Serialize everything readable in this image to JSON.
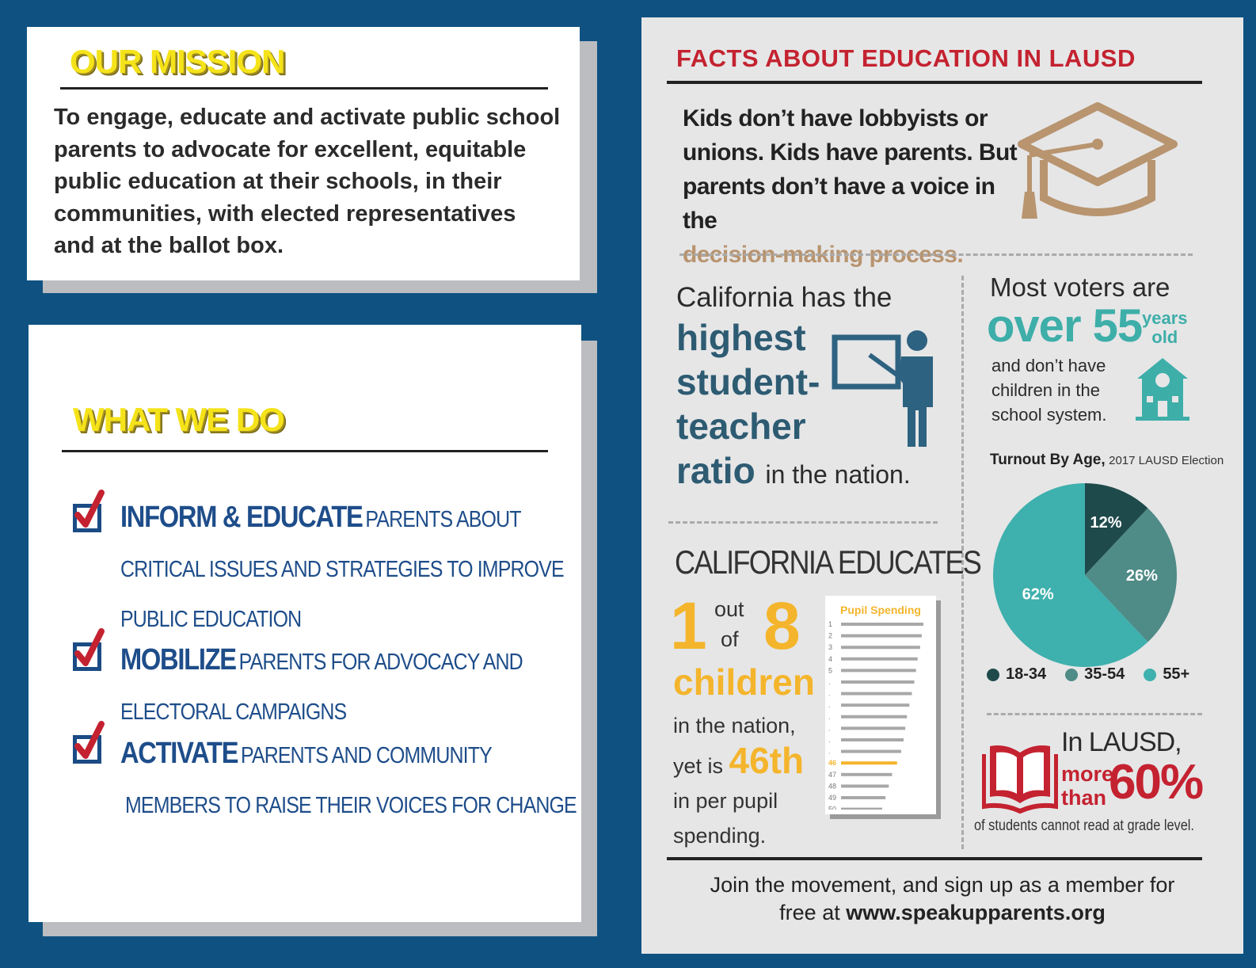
{
  "mission": {
    "heading": "OUR MISSION",
    "text": "To engage, educate and activate public school parents to advocate for excellent, equitable public education at their schools, in their communities, with elected representatives and at the ballot box."
  },
  "what_we_do": {
    "heading": "WHAT WE DO",
    "items": [
      {
        "lead": "INFORM & EDUCATE",
        "line1": "PARENTS ABOUT",
        "line2": "CRITICAL ISSUES AND STRATEGIES TO IMPROVE",
        "line3": "PUBLIC EDUCATION"
      },
      {
        "lead": "MOBILIZE",
        "line1": "PARENTS FOR ADVOCACY AND",
        "line2": "ELECTORAL CAMPAIGNS"
      },
      {
        "lead": "ACTIVATE",
        "line1": "PARENTS AND COMMUNITY",
        "line2": "MEMBERS TO RAISE THEIR VOICES FOR CHANGE"
      }
    ]
  },
  "facts": {
    "title": "FACTS ABOUT EDUCATION IN LAUSD",
    "kids_line1": "Kids don’t have lobbyists or",
    "kids_line2": "unions. Kids have parents. But",
    "kids_line3": "parents don’t have a voice in the",
    "kids_highlight": "decision-making process.",
    "ratio_intro": "California has the",
    "ratio_w1": "highest",
    "ratio_w2": "student-",
    "ratio_w3": "teacher",
    "ratio_w4": "ratio",
    "ratio_tail": "in the nation.",
    "voters_intro": "Most voters are",
    "voters_big": "over 55",
    "voters_years": "years",
    "voters_old": "old",
    "voters_l1": "and don’t have",
    "voters_l2": "children in the",
    "voters_l3": "school system.",
    "educates_title": "CALIFORNIA EDUCATES",
    "num1": "1",
    "out": "out",
    "of": "of",
    "num8": "8",
    "children": "children",
    "in_nation": "in the nation,",
    "yet_is": "yet is",
    "rank": "46th",
    "per_pupil": "in per pupil",
    "spending": "spending.",
    "read_intro": "In LAUSD,",
    "read_more": "more",
    "read_than": "than",
    "read_pct": "60%",
    "read_tail": "of students cannot read at grade level.",
    "footer_l1": "Join the movement, and sign up as a member for",
    "footer_free": "free at",
    "footer_url": "www.speakupparents.org"
  },
  "colors": {
    "page_bg": "#0f5282",
    "yellow": "#f5e31a",
    "red": "#c42230",
    "blue_text": "#1e4d8a",
    "teal_dark": "#2d5b72",
    "orange": "#f4b52c",
    "tan": "#b8946f"
  },
  "icons": [
    "checkmark-icon",
    "graduation-cap-icon",
    "teacher-board-icon",
    "schoolhouse-icon",
    "book-icon"
  ],
  "chart_data": [
    {
      "type": "pie",
      "title": "Turnout By Age,",
      "subtitle": "2017 LAUSD Election",
      "categories": [
        "18-34",
        "35-54",
        "55+"
      ],
      "values": [
        12,
        26,
        62
      ],
      "labels": [
        "12%",
        "26%",
        "62%"
      ],
      "colors": [
        "#1f4a4b",
        "#4f8b87",
        "#3eb0ad"
      ],
      "legend": "bottom"
    },
    {
      "type": "bar",
      "title": "Pupil Spending",
      "categories": [
        "1",
        "2",
        "3",
        "4",
        "5",
        ".",
        ".",
        ".",
        ".",
        ".",
        ".",
        ".",
        "46",
        "47",
        "48",
        "49",
        "50"
      ],
      "values": [
        100,
        98,
        96,
        93,
        91,
        89,
        86,
        83,
        80,
        78,
        76,
        73,
        68,
        62,
        58,
        54,
        50
      ],
      "highlight": "46",
      "orientation": "horizontal"
    }
  ]
}
